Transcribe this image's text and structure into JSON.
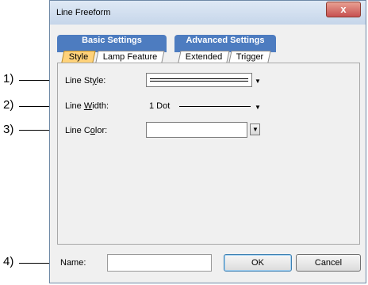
{
  "dialog": {
    "title": "Line Freeform",
    "close_label": "x"
  },
  "tabs": {
    "basic": {
      "label": "Basic Settings",
      "subtabs": [
        "Style",
        "Lamp Feature"
      ]
    },
    "advanced": {
      "label": "Advanced Settings",
      "subtabs": [
        "Extended",
        "Trigger"
      ]
    },
    "active_subtab": "Style"
  },
  "fields": {
    "line_style": {
      "label_pre": "Line St",
      "label_u": "y",
      "label_post": "le:"
    },
    "line_width": {
      "label_pre": "Line ",
      "label_u": "W",
      "label_post": "idth:",
      "value": "1 Dot"
    },
    "line_color": {
      "label_pre": "Line C",
      "label_u": "o",
      "label_post": "lor:"
    }
  },
  "footer": {
    "name_label": "Name:",
    "name_value": "",
    "ok_label": "OK",
    "cancel_label": "Cancel"
  },
  "callouts": [
    "1)",
    "2)",
    "3)",
    "4)"
  ]
}
